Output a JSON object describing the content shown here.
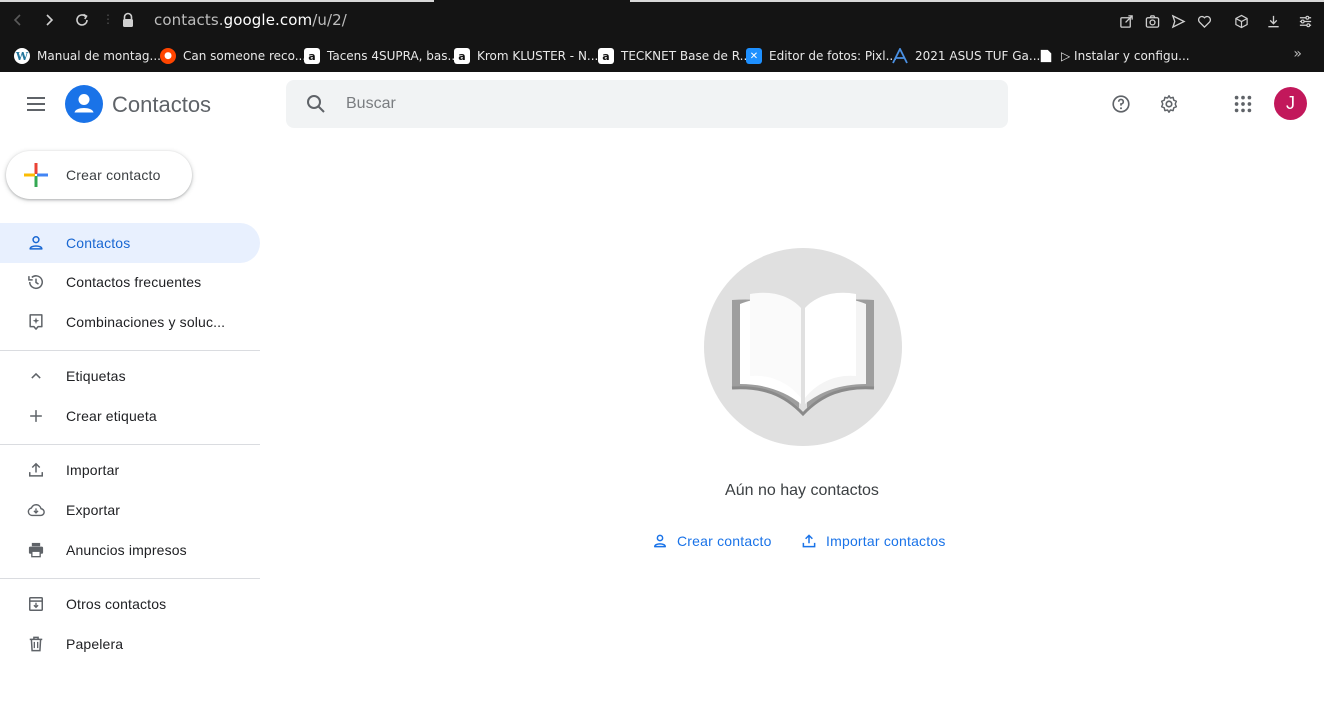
{
  "browser": {
    "url_prefix": "contacts.",
    "url_domain": "google.com",
    "url_path": "/u/2/",
    "bookmarks": [
      {
        "label": "Manual de montag...",
        "icon": "wordpress-icon"
      },
      {
        "label": "Can someone reco...",
        "icon": "reddit-icon"
      },
      {
        "label": "Tacens 4SUPRA, bas...",
        "icon": "amazon-icon"
      },
      {
        "label": "Krom KLUSTER - N...",
        "icon": "amazon-icon"
      },
      {
        "label": "TECKNET Base de R...",
        "icon": "amazon-icon"
      },
      {
        "label": "Editor de fotos: Pixl...",
        "icon": "pixlr-icon"
      },
      {
        "label": "2021 ASUS TUF Ga...",
        "icon": "asus-icon"
      },
      {
        "label": "▷ Instalar y configu...",
        "icon": "document-icon"
      }
    ],
    "more_bookmarks": "»"
  },
  "header": {
    "app_title": "Contactos",
    "search_placeholder": "Buscar",
    "avatar_initial": "J"
  },
  "sidebar": {
    "create_label": "Crear contacto",
    "items": [
      {
        "label": "Contactos",
        "icon": "person-icon",
        "active": true
      },
      {
        "label": "Contactos frecuentes",
        "icon": "history-icon"
      },
      {
        "label": "Combinaciones y soluc...",
        "icon": "merge-icon"
      },
      {
        "label": "Etiquetas",
        "icon": "chevron-up-icon"
      },
      {
        "label": "Crear etiqueta",
        "icon": "plus-icon"
      },
      {
        "label": "Importar",
        "icon": "upload-icon"
      },
      {
        "label": "Exportar",
        "icon": "cloud-download-icon"
      },
      {
        "label": "Anuncios impresos",
        "icon": "printer-icon"
      },
      {
        "label": "Otros contactos",
        "icon": "archive-icon"
      },
      {
        "label": "Papelera",
        "icon": "trash-icon"
      }
    ]
  },
  "main": {
    "empty_message": "Aún no hay contactos",
    "create_contact_link": "Crear contacto",
    "import_contacts_link": "Importar contactos"
  },
  "colors": {
    "accent": "#1a73e8",
    "active_bg": "#e8f0fe",
    "avatar": "#c2185b",
    "chrome_bg": "#141414"
  }
}
